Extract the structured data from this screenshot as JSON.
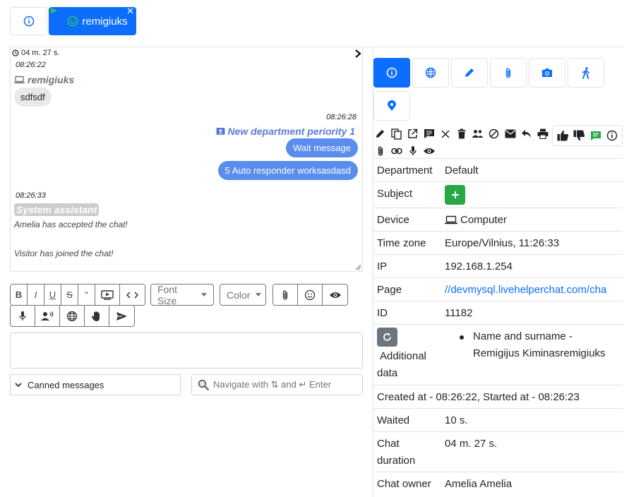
{
  "top_tabs": {
    "info_icon": "info-circle-icon",
    "active_user": "remigiuks",
    "close": "✕"
  },
  "messages": {
    "duration": "04 m. 27 s.",
    "items": [
      {
        "time": "08:26:22",
        "author": "remigiuks",
        "text": "sdfsdf"
      },
      {
        "time": "08:26:28",
        "author": "New department periority 1",
        "texts": [
          "Wait message",
          "5 Auto responder worksasdasd"
        ]
      },
      {
        "time": "08:26:33",
        "author": "System assistant",
        "texts": [
          "Amelia has accepted the chat!",
          "Visitor has joined the chat!"
        ]
      }
    ]
  },
  "editor": {
    "bold": "B",
    "italic": "I",
    "underline": "U",
    "strike": "S",
    "quote": "“",
    "font_size": "Font Size",
    "color": "Color",
    "canned": "Canned messages",
    "search_placeholder": "Navigate with ⇅ and ↵ Enter"
  },
  "details": {
    "rows": [
      {
        "key": "Department",
        "value": "Default"
      },
      {
        "key": "Subject",
        "value": ""
      },
      {
        "key": "Device",
        "value": "Computer"
      },
      {
        "key": "Time zone",
        "value": "Europe/Vilnius, 11:26:33"
      },
      {
        "key": "IP",
        "value": "192.168.1.254"
      },
      {
        "key": "Page",
        "value": "//devmysql.livehelperchat.com/cha"
      },
      {
        "key": "ID",
        "value": "11182"
      },
      {
        "key": "Additional data",
        "value": "Name and surname - Remigijus Kiminasremigiuks"
      },
      {
        "key": "Created at - 08:26:22, Started at - 08:26:23",
        "value": ""
      },
      {
        "key": "Waited",
        "value": "10 s."
      },
      {
        "key": "Chat duration",
        "value": "04 m. 27 s."
      },
      {
        "key": "Chat owner",
        "value": "Amelia Amelia"
      }
    ],
    "additional_line1": "Name and surname -",
    "additional_line2": "Remigijus Kiminasremigiuks",
    "additional_key1": "Additional",
    "additional_key2": "data",
    "chat_duration_key1": "Chat",
    "chat_duration_key2": "duration"
  },
  "colors": {
    "primary": "#0d6efd",
    "bubble_blue": "#5a8dee",
    "success": "#28a745"
  }
}
